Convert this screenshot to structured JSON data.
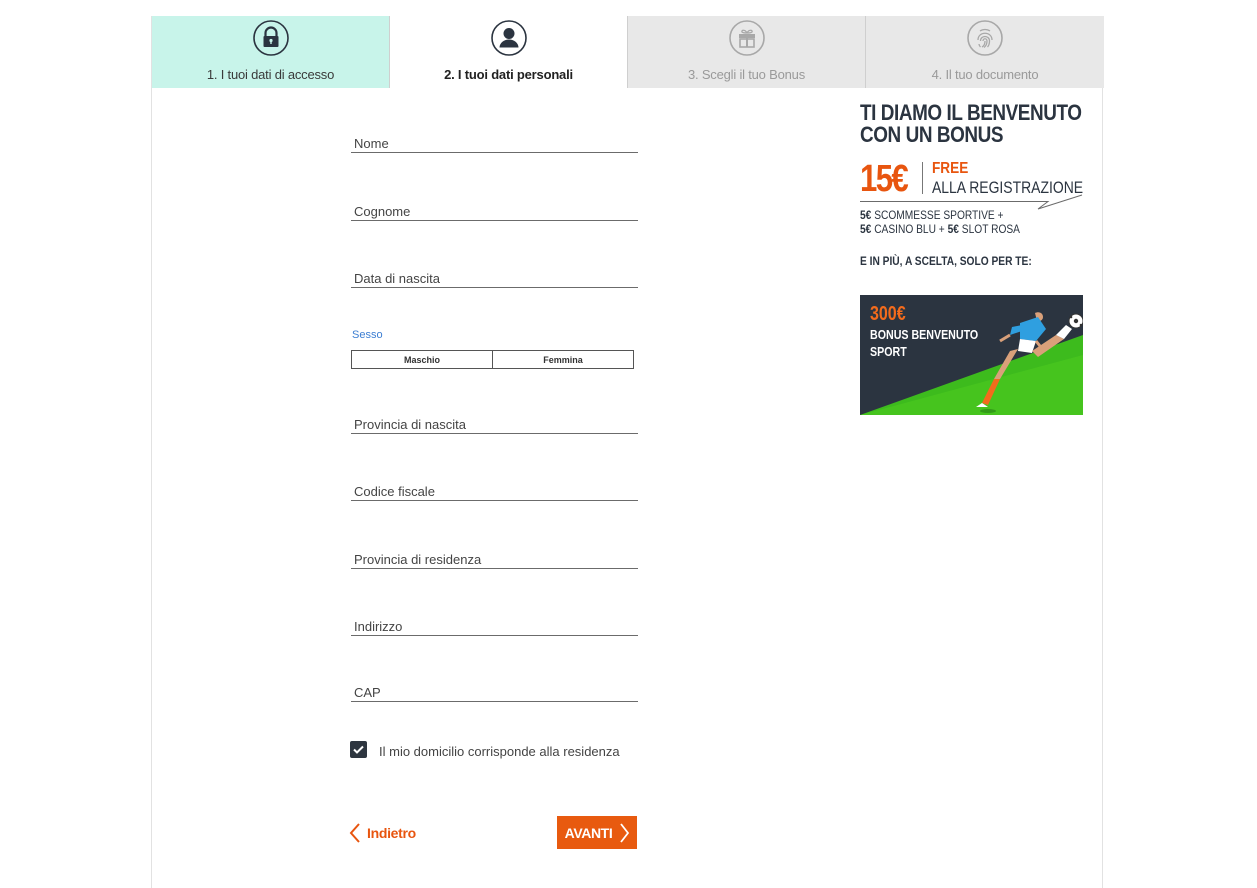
{
  "steps": [
    {
      "label": "1.  I tuoi dati di accesso",
      "icon": "lock-icon",
      "state": "done"
    },
    {
      "label": "2.  I tuoi dati personali",
      "icon": "user-icon",
      "state": "active"
    },
    {
      "label": "3.  Scegli il tuo Bonus",
      "icon": "gift-icon",
      "state": "pending"
    },
    {
      "label": "4.  Il tuo documento",
      "icon": "fingerprint-icon",
      "state": "pending"
    }
  ],
  "form": {
    "nome_placeholder": "Nome",
    "cognome_placeholder": "Cognome",
    "data_nascita_placeholder": "Data di nascita",
    "sesso_label": "Sesso",
    "sesso_options": [
      "Maschio",
      "Femmina"
    ],
    "provincia_nascita_placeholder": "Provincia di nascita",
    "codice_fiscale_placeholder": "Codice fiscale",
    "provincia_residenza_placeholder": "Provincia di residenza",
    "indirizzo_placeholder": "Indirizzo",
    "cap_placeholder": "CAP",
    "domicilio_checkbox_label": "Il mio domicilio corrisponde alla residenza",
    "domicilio_checked": true
  },
  "nav": {
    "back_label": "Indietro",
    "next_label": "AVANTI"
  },
  "promo": {
    "title_line1": "TI DIAMO IL BENVENUTO",
    "title_line2": "CON UN BONUS",
    "amount": "15€",
    "free": "FREE",
    "registration": "ALLA REGISTRAZIONE",
    "detail_line1_amount": "5€",
    "detail_line1_text": " SCOMMESSE SPORTIVE +",
    "detail_line2_amount_a": "5€",
    "detail_line2_text_a": " CASINO BLU + ",
    "detail_line2_amount_b": "5€",
    "detail_line2_text_b": " SLOT ROSA",
    "extra": "E IN PIÙ, A SCELTA, SOLO PER TE:",
    "banner_amount": "300€",
    "banner_line1": "BONUS BENVENUTO",
    "banner_line2": "SPORT"
  },
  "colors": {
    "accent": "#e8550f",
    "step_done": "#c8f4ea",
    "step_pending": "#e8e8e8",
    "banner_dark": "#2b3440",
    "banner_green": "#3dbb1d"
  }
}
